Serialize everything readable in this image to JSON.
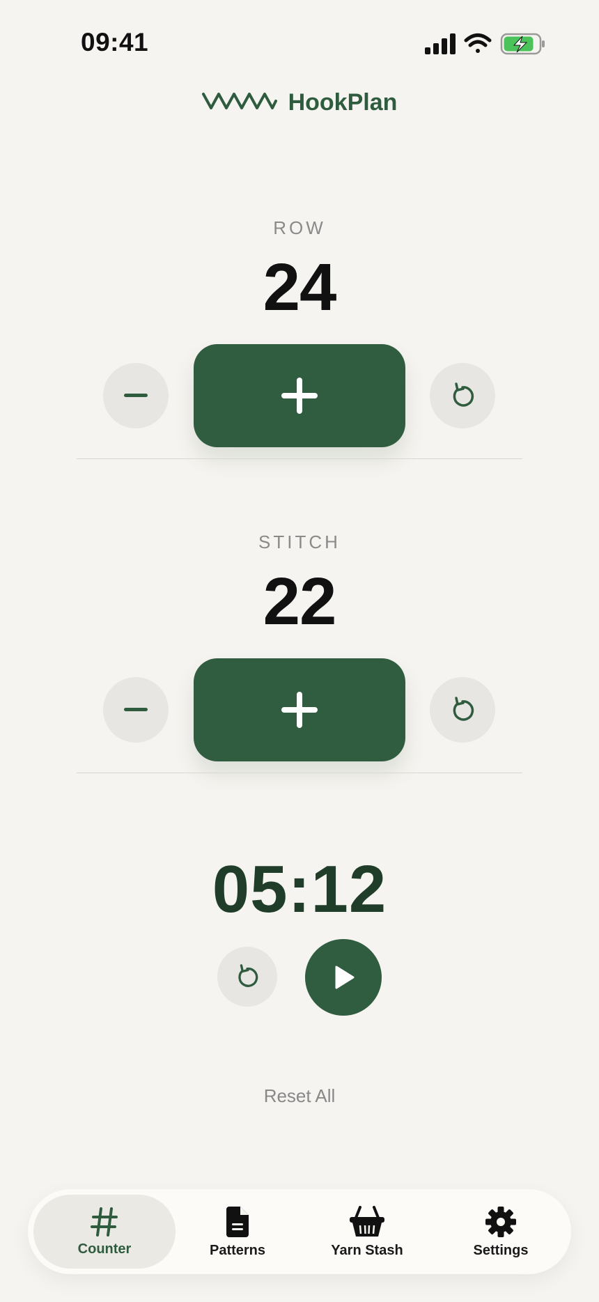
{
  "status_bar": {
    "time": "09:41"
  },
  "header": {
    "app_name": "HookPlan",
    "logo_icon": "zigzag-stitch-icon"
  },
  "counters": [
    {
      "label": "ROW",
      "value": "24"
    },
    {
      "label": "STITCH",
      "value": "22"
    }
  ],
  "timer": {
    "value": "05:12",
    "state": "paused"
  },
  "actions": {
    "reset_all": "Reset All"
  },
  "tabbar": {
    "items": [
      {
        "label": "Counter",
        "icon": "hash-icon",
        "active": true
      },
      {
        "label": "Patterns",
        "icon": "document-icon",
        "active": false
      },
      {
        "label": "Yarn Stash",
        "icon": "basket-icon",
        "active": false
      },
      {
        "label": "Settings",
        "icon": "gear-icon",
        "active": false
      }
    ]
  },
  "colors": {
    "accent": "#305c3f",
    "background": "#f6f4f0",
    "button_bg": "#e8e6e2",
    "battery": "#4cc35a"
  }
}
